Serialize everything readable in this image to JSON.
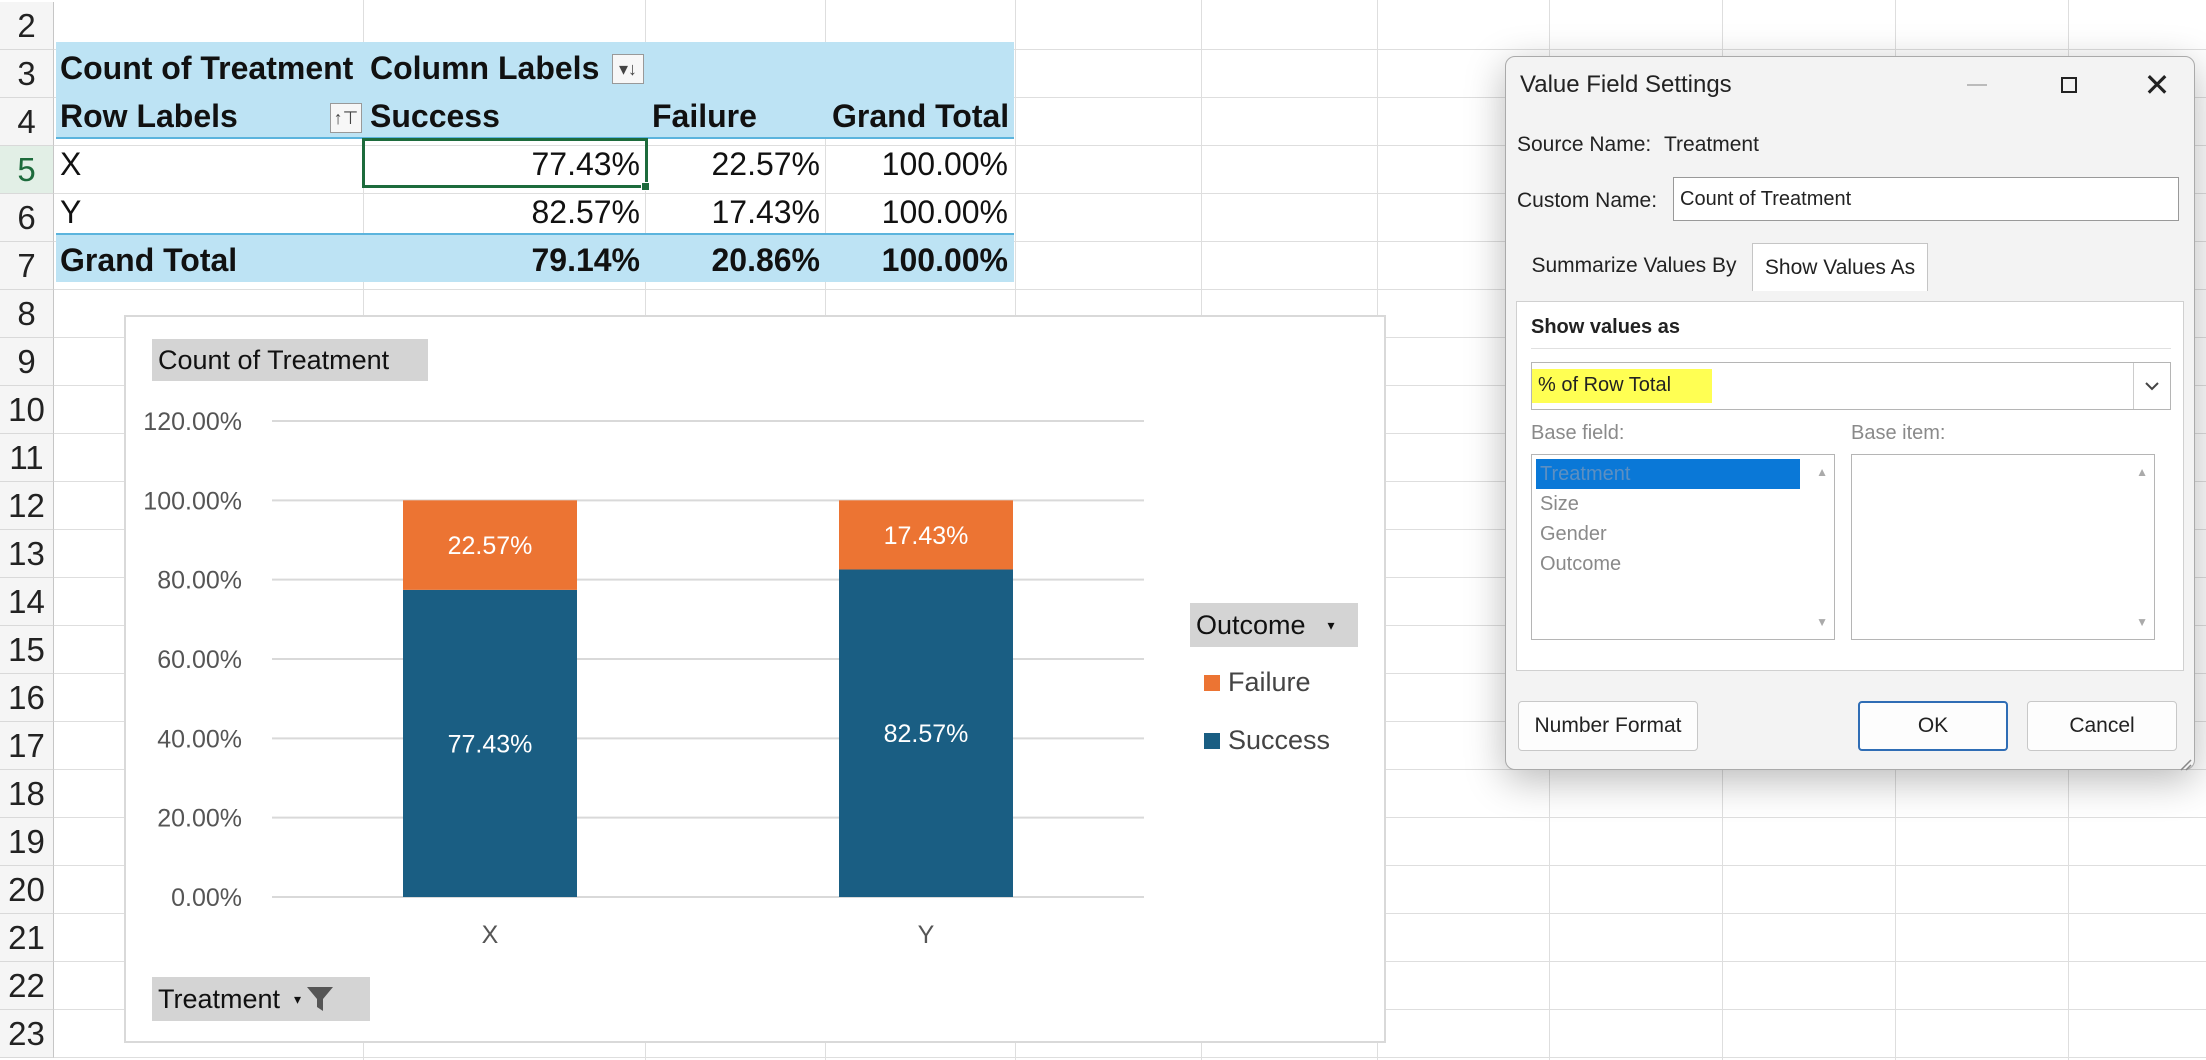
{
  "row_numbers": [
    "2",
    "3",
    "4",
    "5",
    "6",
    "7",
    "8",
    "9",
    "10",
    "11",
    "12",
    "13",
    "14",
    "15",
    "16",
    "17",
    "18",
    "19",
    "20",
    "21",
    "22",
    "23"
  ],
  "pivot": {
    "value_field": "Count of Treatment",
    "column_labels": "Column Labels",
    "row_labels": "Row Labels",
    "col_headers": [
      "Success",
      "Failure",
      "Grand Total"
    ],
    "rows": [
      {
        "label": "X",
        "values": [
          "77.43%",
          "22.57%",
          "100.00%"
        ]
      },
      {
        "label": "Y",
        "values": [
          "82.57%",
          "17.43%",
          "100.00%"
        ]
      }
    ],
    "grand_total": {
      "label": "Grand Total",
      "values": [
        "79.14%",
        "20.86%",
        "100.00%"
      ]
    }
  },
  "chart_data": {
    "type": "bar",
    "stacked": true,
    "categories": [
      "X",
      "Y"
    ],
    "series": [
      {
        "name": "Success",
        "values": [
          77.43,
          82.57
        ],
        "color": "#1a5e83",
        "labels": [
          "77.43%",
          "82.57%"
        ]
      },
      {
        "name": "Failure",
        "values": [
          22.57,
          17.43
        ],
        "color": "#ec7433",
        "labels": [
          "22.57%",
          "17.43%"
        ]
      }
    ],
    "ylim": [
      0,
      120
    ],
    "yticks": [
      "0.00%",
      "20.00%",
      "40.00%",
      "60.00%",
      "80.00%",
      "100.00%",
      "120.00%"
    ],
    "grid": true,
    "legend_title": "Outcome",
    "legend": [
      "Failure",
      "Success"
    ],
    "legend_position": "right",
    "value_field_button": "Count of Treatment",
    "axis_field_button": "Treatment"
  },
  "dialog": {
    "title": "Value Field Settings",
    "source_name_label": "Source Name:",
    "source_name_value": "Treatment",
    "custom_name_label": "Custom Name:",
    "custom_name_value": "Count of Treatment",
    "tab_summarize": "Summarize Values By",
    "tab_show": "Show Values As",
    "show_values_heading": "Show values as",
    "show_values_selected": "% of Row Total",
    "base_field_label": "Base field:",
    "base_item_label": "Base item:",
    "base_fields": [
      "Treatment",
      "Size",
      "Gender",
      "Outcome"
    ],
    "number_format_button": "Number Format",
    "ok_button": "OK",
    "cancel_button": "Cancel",
    "highlight_color": "#ffff40",
    "selection_color": "#0a78d7"
  }
}
